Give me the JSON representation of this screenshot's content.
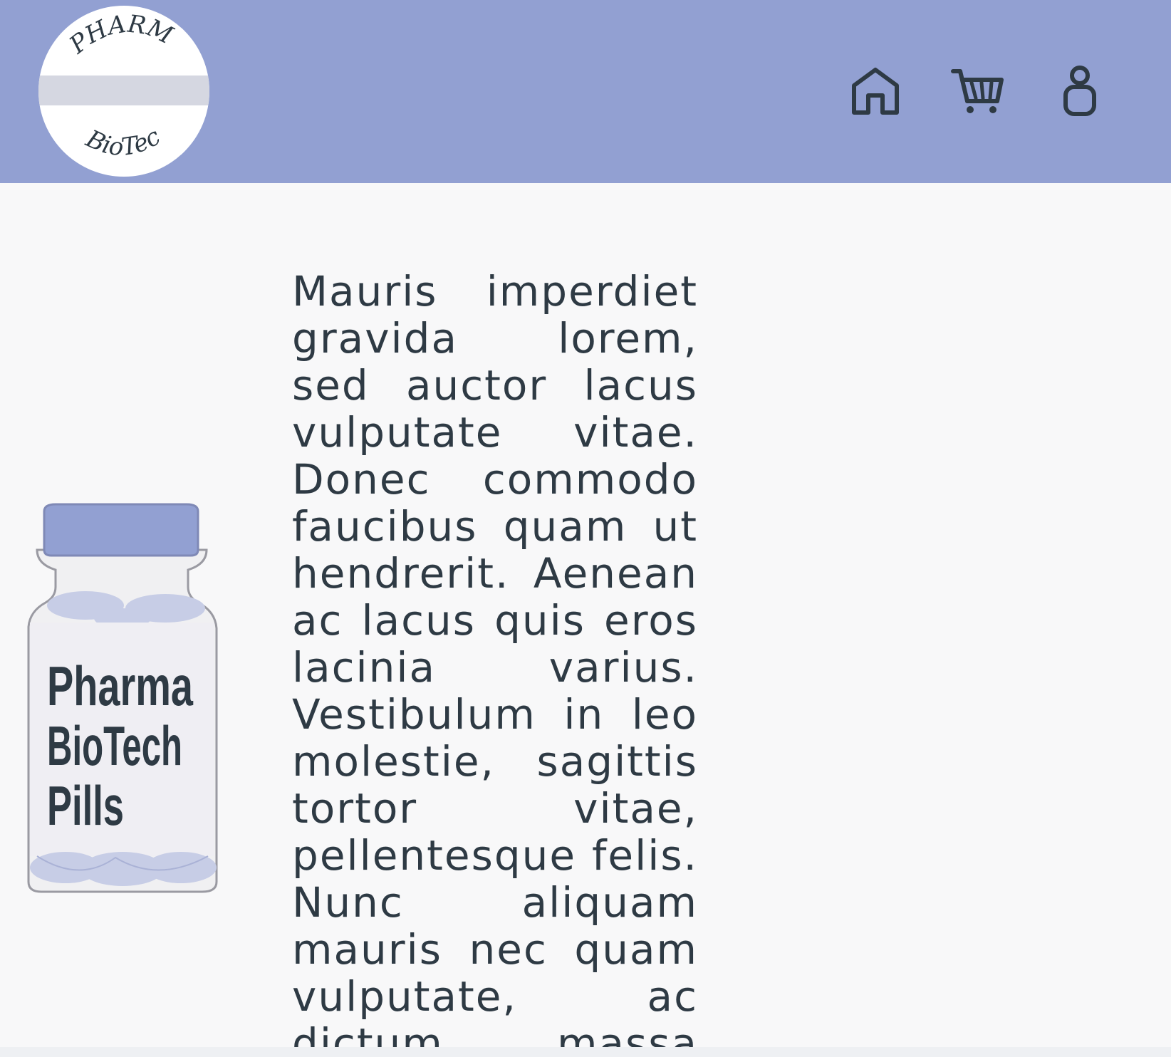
{
  "header": {
    "logo": {
      "top_text": "PHARMA",
      "bottom_text": "BioTech"
    },
    "nav": [
      {
        "name": "home",
        "icon": "home-icon"
      },
      {
        "name": "cart",
        "icon": "cart-icon"
      },
      {
        "name": "account",
        "icon": "user-icon"
      }
    ]
  },
  "product": {
    "label_lines": [
      "Pharma",
      "BioTech",
      "Pills"
    ],
    "cap_color": "#92a0d2",
    "pill_color": "#c7cde6"
  },
  "main": {
    "description": "Mauris imperdiet gravida lorem, sed auctor lacus vulputate vitae. Donec commodo faucibus quam ut hendrerit. Aenean ac lacus quis eros lacinia varius. Vestibulum in leo molestie, sagittis tortor vitae, pellentesque felis. Nunc aliquam mauris nec quam vulputate, ac dictum massa"
  },
  "colors": {
    "header_bg": "#92a0d2",
    "page_bg": "#f8f8f9",
    "text": "#2e3a44",
    "icon_stroke": "#2e3a44"
  }
}
